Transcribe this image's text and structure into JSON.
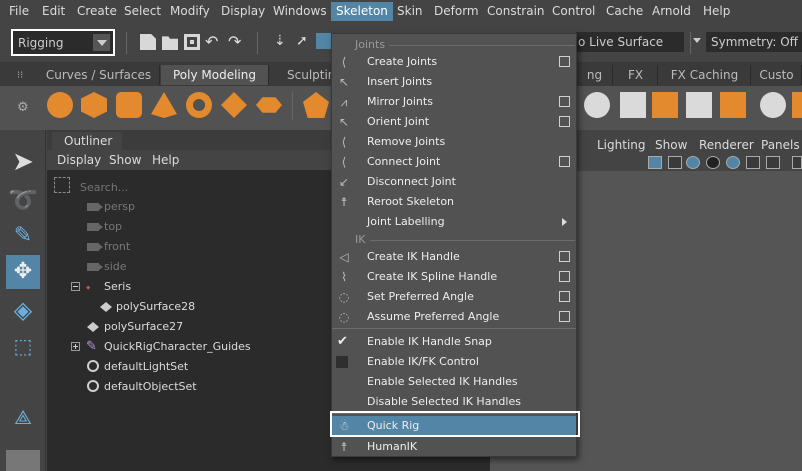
{
  "menubar": {
    "items": [
      "File",
      "Edit",
      "Create",
      "Select",
      "Modify",
      "Display",
      "Windows",
      "Skeleton",
      "Skin",
      "Deform",
      "Constrain",
      "Control",
      "Cache",
      "Arnold",
      "Help"
    ],
    "active": "Skeleton"
  },
  "toolbar": {
    "mode": "Rigging",
    "live_surface": "o Live Surface",
    "symmetry": "Symmetry: Off"
  },
  "shelf": {
    "tabs": [
      "Curves / Surfaces",
      "Poly Modeling",
      "Sculptin",
      "ng",
      "FX",
      "FX Caching",
      "Custo"
    ],
    "active": "Poly Modeling"
  },
  "outliner": {
    "tab": "Outliner",
    "menu": [
      "Display",
      "Show",
      "Help"
    ],
    "search_placeholder": "Search...",
    "rows": [
      "persp",
      "top",
      "front",
      "side",
      "Seris",
      "polySurface28",
      "polySurface27",
      "QuickRigCharacter_Guides",
      "defaultLightSet",
      "defaultObjectSet"
    ]
  },
  "viewport": {
    "menu": [
      "Lighting",
      "Show",
      "Renderer",
      "Panels"
    ]
  },
  "skeleton_menu": {
    "sections": [
      "Joints",
      "IK"
    ],
    "items": [
      "Create Joints",
      "Insert Joints",
      "Mirror Joints",
      "Orient Joint",
      "Remove Joints",
      "Connect Joint",
      "Disconnect Joint",
      "Reroot Skeleton",
      "Joint Labelling",
      "Create IK Handle",
      "Create IK Spline Handle",
      "Set Preferred Angle",
      "Assume Preferred Angle",
      "Enable IK Handle Snap",
      "Enable IK/FK Control",
      "Enable Selected IK Handles",
      "Disable Selected IK Handles",
      "Quick Rig",
      "HumanIK"
    ],
    "highlighted": "Quick Rig"
  },
  "colors": {
    "highlight": "#5285a6",
    "menu_bg": "#525252",
    "panel_bg": "#444444",
    "outliner_bg": "#2b2b2b"
  }
}
